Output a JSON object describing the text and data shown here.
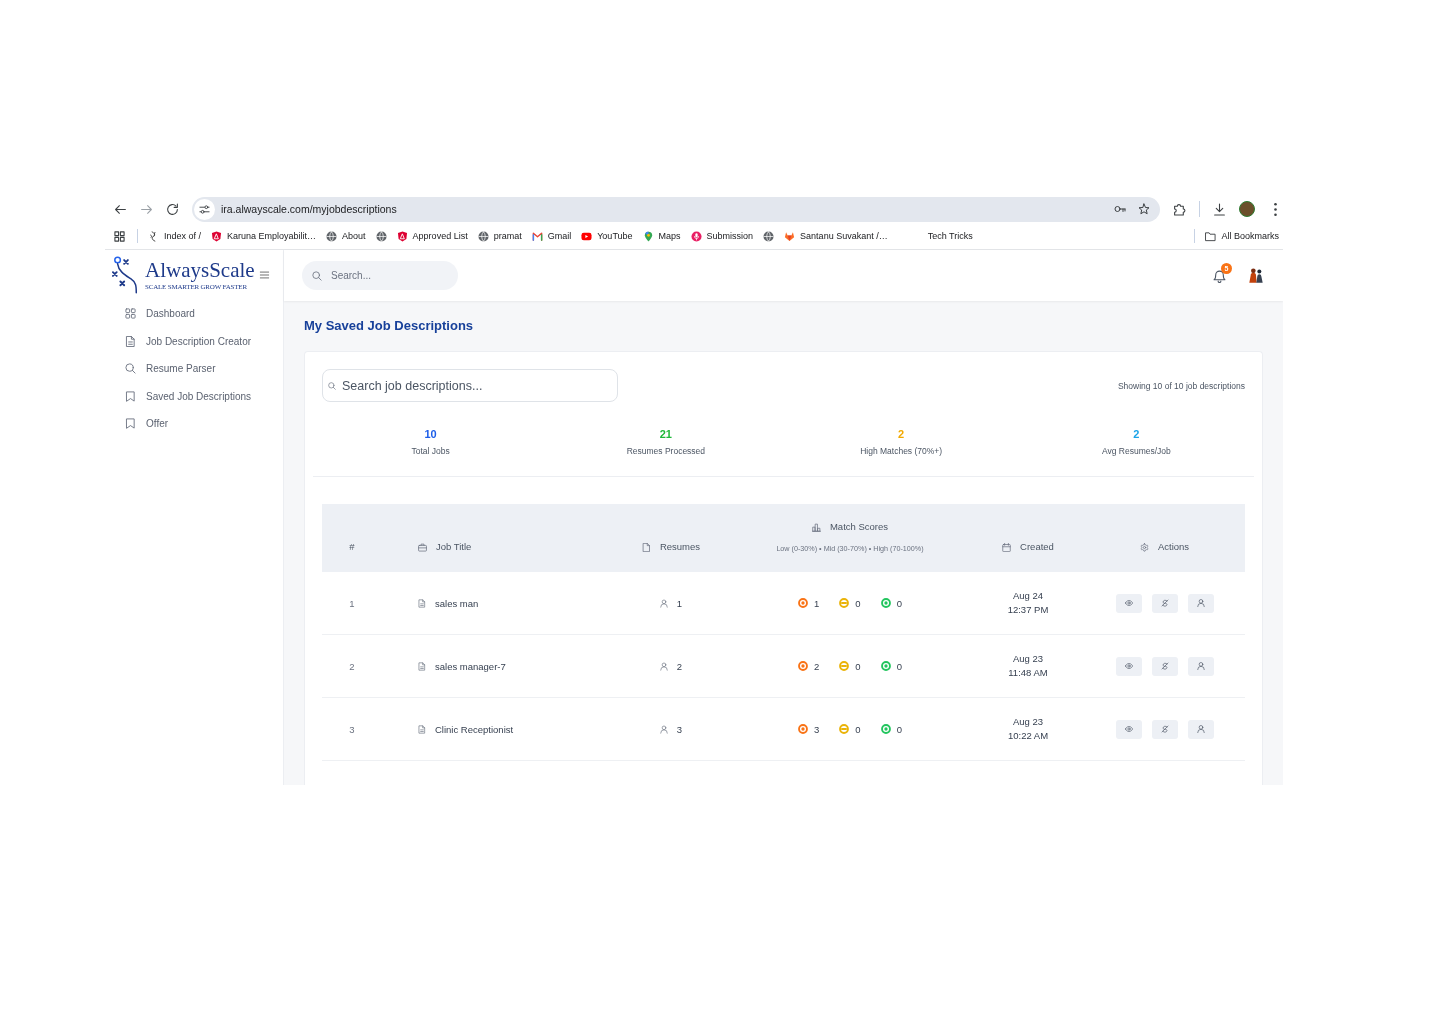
{
  "browser": {
    "url": "ira.alwayscale.com/myjobdescriptions",
    "bookmarks": [
      {
        "kind": "feather",
        "label": "Index of /"
      },
      {
        "kind": "shield",
        "label": "Karuna Employabilit…"
      },
      {
        "kind": "globe",
        "label": "About"
      },
      {
        "kind": "globe"
      },
      {
        "kind": "shield",
        "label": "Approved List"
      },
      {
        "kind": "globe",
        "label": "pramat"
      },
      {
        "kind": "mail",
        "label": "Gmail"
      },
      {
        "kind": "video",
        "label": "YouTube"
      },
      {
        "kind": "pin",
        "label": "Maps"
      },
      {
        "kind": "mic",
        "label": "Submission"
      },
      {
        "kind": "globe"
      },
      {
        "kind": "fox",
        "label": "Santanu Suvakant /…"
      },
      {
        "kind": "none",
        "label": "Tech Tricks"
      }
    ],
    "all_bookmarks": "All Bookmarks"
  },
  "sidebar": {
    "logo": {
      "name": "AlwaysScale",
      "tagline": "SCALE SMARTER GROW FASTER"
    },
    "items": [
      {
        "kind": "grid",
        "label": "Dashboard",
        "selected": false
      },
      {
        "kind": "document",
        "label": "Job Description Creator",
        "selected": false
      },
      {
        "kind": "search",
        "label": "Resume Parser",
        "selected": false
      },
      {
        "kind": "bookmark",
        "label": "Saved Job Descriptions",
        "selected": false
      },
      {
        "kind": "bookmark",
        "label": "Offer",
        "selected": false
      }
    ]
  },
  "header": {
    "search": {
      "placeholder": "Search..."
    },
    "notifications": "5"
  },
  "page": {
    "title": "My Saved Job Descriptions",
    "search": {
      "placeholder": "Search job descriptions..."
    },
    "showing": "Showing 10 of 10 job descriptions",
    "stats": [
      {
        "value": "10",
        "label": "Total Jobs",
        "color": "#1d5ee8"
      },
      {
        "value": "21",
        "label": "Resumes Processed",
        "color": "#1fb83a"
      },
      {
        "value": "2",
        "label": "High Matches (70%+)",
        "color": "#f2a900"
      },
      {
        "value": "2",
        "label": "Avg Resumes/Job",
        "color": "#1aa3e8"
      }
    ]
  },
  "table": {
    "columns": [
      {
        "kind": "none",
        "label": "#"
      },
      {
        "kind": "briefcase",
        "label": "Job Title"
      },
      {
        "kind": "file",
        "label": "Resumes"
      },
      {
        "kind": "chart",
        "label": "Match Scores",
        "subtitle": "Low (0-30%) • Mid (30-70%) • High (70-100%)"
      },
      {
        "kind": "calendar",
        "label": "Created"
      },
      {
        "kind": "gear",
        "label": "Actions"
      }
    ],
    "rows": [
      {
        "index": "1",
        "title": "sales man",
        "resumes": "1",
        "scores": [
          {
            "kind": "dot",
            "value": "1",
            "color": "#f97316"
          },
          {
            "kind": "minus",
            "value": "0",
            "color": "#eab308"
          },
          {
            "kind": "dot",
            "value": "0",
            "color": "#22c55e"
          }
        ],
        "created": {
          "date": "Aug 24",
          "time": "12:37 PM"
        }
      },
      {
        "index": "2",
        "title": "sales manager-7",
        "resumes": "2",
        "scores": [
          {
            "kind": "dot",
            "value": "2",
            "color": "#f97316"
          },
          {
            "kind": "minus",
            "value": "0",
            "color": "#eab308"
          },
          {
            "kind": "dot",
            "value": "0",
            "color": "#22c55e"
          }
        ],
        "created": {
          "date": "Aug 23",
          "time": "11:48 AM"
        }
      },
      {
        "index": "3",
        "title": "Clinic Receptionist",
        "resumes": "3",
        "scores": [
          {
            "kind": "dot",
            "value": "3",
            "color": "#f97316"
          },
          {
            "kind": "minus",
            "value": "0",
            "color": "#eab308"
          },
          {
            "kind": "dot",
            "value": "0",
            "color": "#22c55e"
          }
        ],
        "created": {
          "date": "Aug 23",
          "time": "10:22 AM"
        }
      }
    ],
    "row_actions": [
      {
        "kind": "eye"
      },
      {
        "kind": "curve"
      },
      {
        "kind": "person"
      }
    ]
  }
}
